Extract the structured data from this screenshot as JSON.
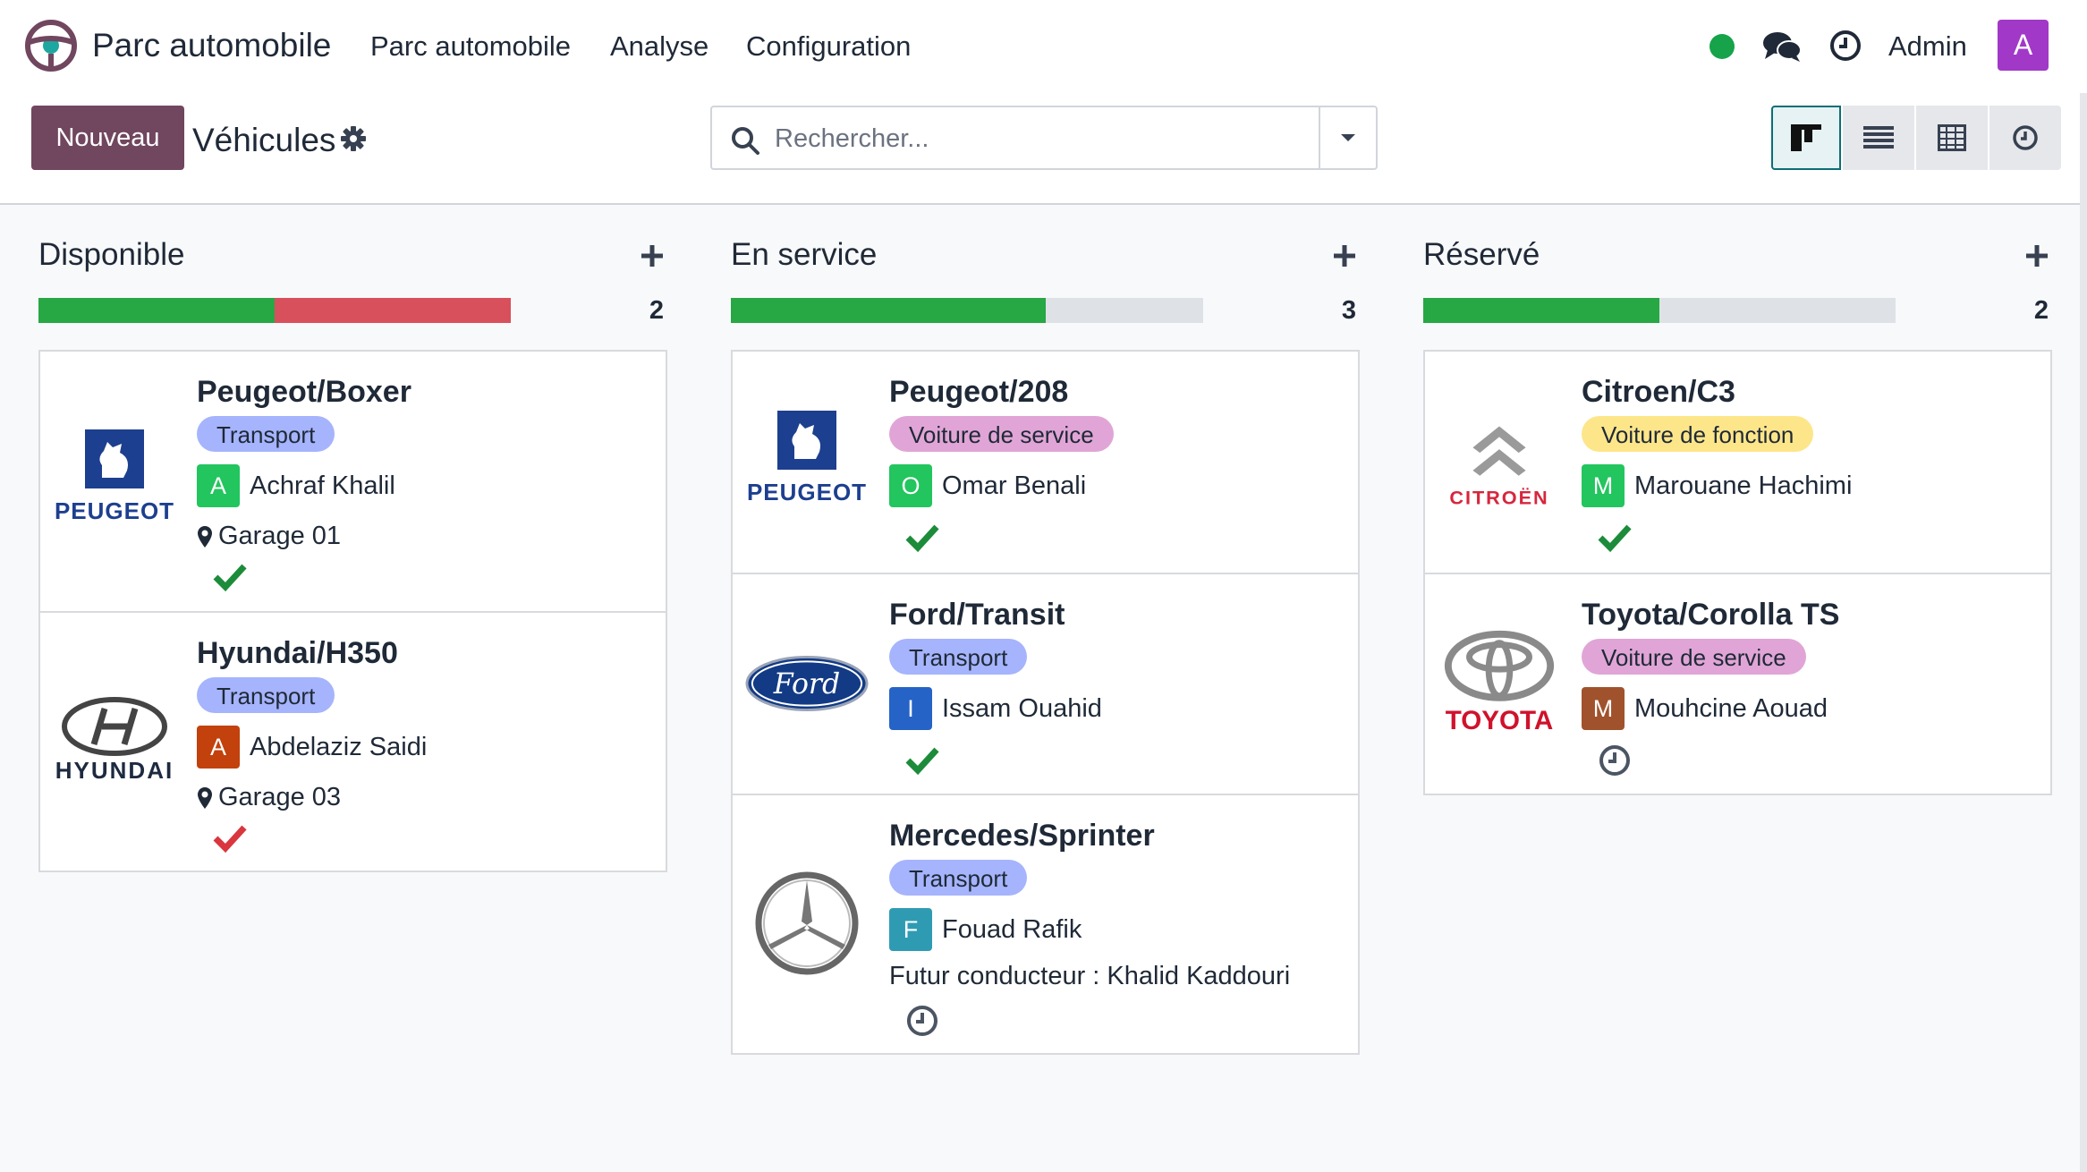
{
  "app": {
    "title": "Parc automobile"
  },
  "menu": [
    "Parc automobile",
    "Analyse",
    "Configuration"
  ],
  "user": {
    "name": "Admin",
    "avatar_letter": "A",
    "avatar_color": "#a238c8"
  },
  "control": {
    "new_label": "Nouveau",
    "breadcrumb": "Véhicules",
    "search_placeholder": "Rechercher..."
  },
  "views": [
    "kanban-icon",
    "list-icon",
    "pivot-icon",
    "activity-icon"
  ],
  "colors": {
    "brand": "#71465f",
    "success": "#28a745",
    "danger": "#dc4c5a",
    "accent": "#0d6e76"
  },
  "columns": [
    {
      "title": "Disponible",
      "count": "2",
      "progress": [
        {
          "color": "#28a745",
          "fraction": 0.5
        },
        {
          "color": "#d9505d",
          "fraction": 0.5
        }
      ],
      "cards": [
        {
          "title": "Peugeot/Boxer",
          "tag": "Transport",
          "tag_color": "#a5b4fc",
          "driver_letter": "A",
          "driver_color": "#22c55e",
          "driver": "Achraf Khalil",
          "location": "Garage 01",
          "logo": "peugeot-logo",
          "state": "check-green"
        },
        {
          "title": "Hyundai/H350",
          "tag": "Transport",
          "tag_color": "#a5b4fc",
          "driver_letter": "A",
          "driver_color": "#c2410c",
          "driver": "Abdelaziz Saidi",
          "location": "Garage 03",
          "logo": "hyundai-logo",
          "state": "check-red"
        }
      ]
    },
    {
      "title": "En service",
      "count": "3",
      "progress": [
        {
          "color": "#28a745",
          "fraction": 0.667
        }
      ],
      "cards": [
        {
          "title": "Peugeot/208",
          "tag": "Voiture de service",
          "tag_color": "#e0a5d6",
          "driver_letter": "O",
          "driver_color": "#22c55e",
          "driver": "Omar Benali",
          "logo": "peugeot-logo",
          "state": "check-green"
        },
        {
          "title": "Ford/Transit",
          "tag": "Transport",
          "tag_color": "#a5b4fc",
          "driver_letter": "I",
          "driver_color": "#2563c6",
          "driver": "Issam Ouahid",
          "logo": "ford-logo",
          "state": "check-green"
        },
        {
          "title": "Mercedes/Sprinter",
          "tag": "Transport",
          "tag_color": "#a5b4fc",
          "driver_letter": "F",
          "driver_color": "#2f9bb3",
          "driver": "Fouad Rafik",
          "future": "Futur conducteur : Khalid Kaddouri",
          "logo": "mercedes-logo",
          "state": "clock"
        }
      ]
    },
    {
      "title": "Réservé",
      "count": "2",
      "progress": [
        {
          "color": "#28a745",
          "fraction": 0.5
        }
      ],
      "cards": [
        {
          "title": "Citroen/C3",
          "tag": "Voiture de fonction",
          "tag_color": "#fde68a",
          "driver_letter": "M",
          "driver_color": "#22c55e",
          "driver": "Marouane Hachimi",
          "logo": "citroen-logo",
          "state": "check-green"
        },
        {
          "title": "Toyota/Corolla TS",
          "tag": "Voiture de service",
          "tag_color": "#e0a5d6",
          "driver_letter": "M",
          "driver_color": "#a0522d",
          "driver": "Mouhcine Aouad",
          "logo": "toyota-logo",
          "state": "clock"
        }
      ]
    }
  ]
}
